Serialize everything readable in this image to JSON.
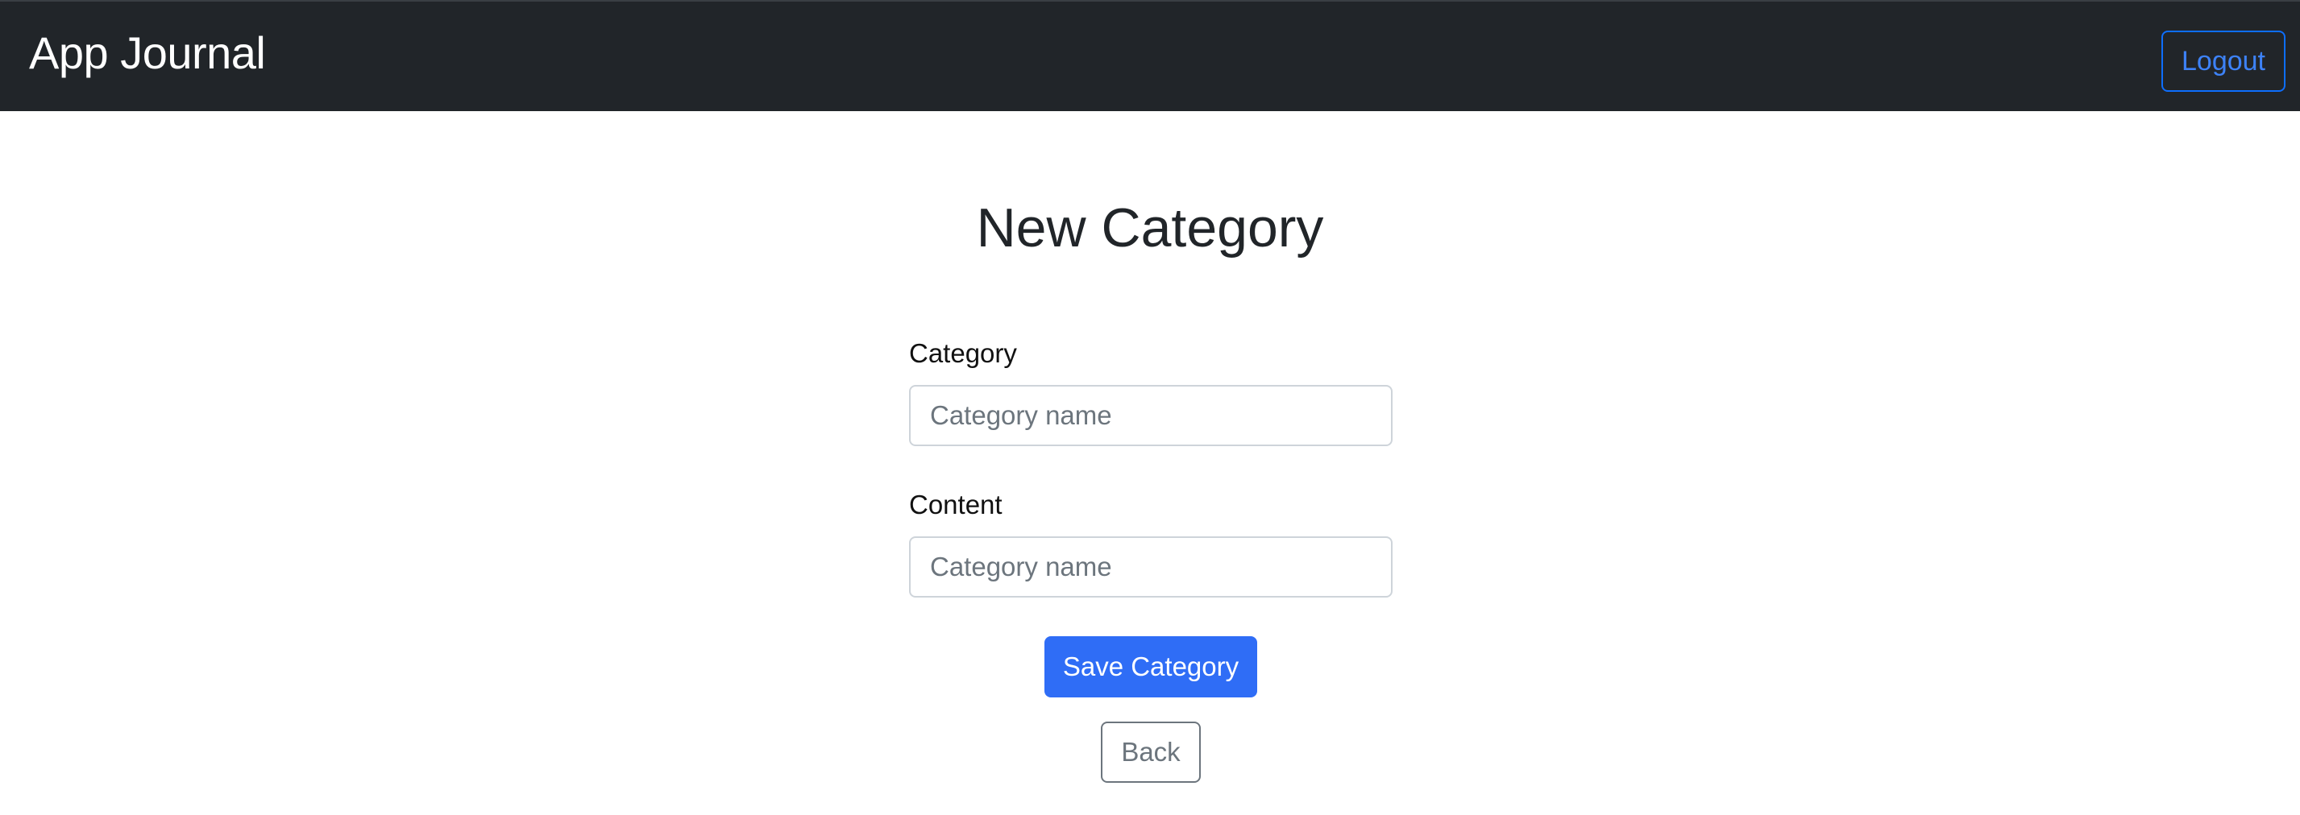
{
  "navbar": {
    "brand": "App Journal",
    "logout_label": "Logout"
  },
  "page": {
    "title": "New Category"
  },
  "form": {
    "category": {
      "label": "Category",
      "placeholder": "Category name",
      "value": ""
    },
    "content": {
      "label": "Content",
      "placeholder": "Category name",
      "value": ""
    },
    "save_label": "Save Category",
    "back_label": "Back"
  },
  "colors": {
    "navbar_bg": "#212529",
    "primary": "#2f6df6",
    "secondary": "#6c757d"
  }
}
